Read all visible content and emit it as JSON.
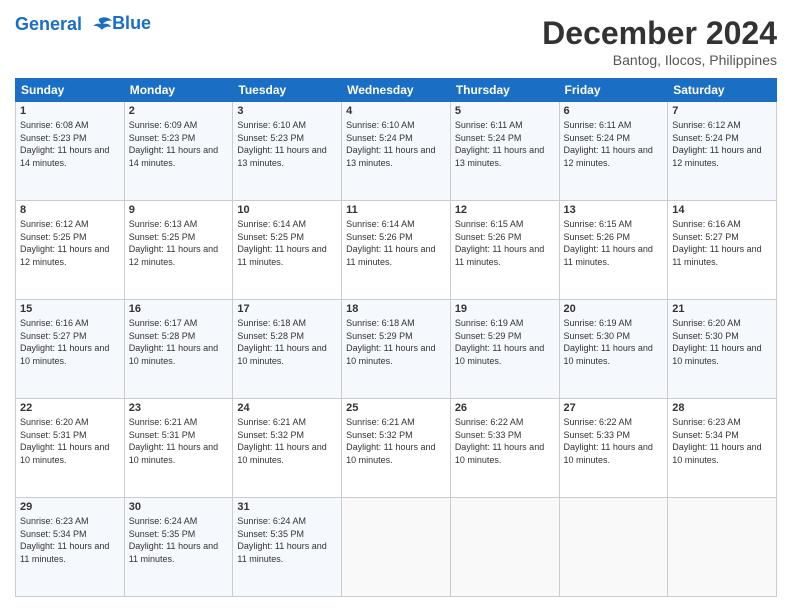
{
  "logo": {
    "line1": "General",
    "line2": "Blue"
  },
  "title": "December 2024",
  "location": "Bantog, Ilocos, Philippines",
  "header_days": [
    "Sunday",
    "Monday",
    "Tuesday",
    "Wednesday",
    "Thursday",
    "Friday",
    "Saturday"
  ],
  "weeks": [
    [
      {
        "day": "1",
        "sunrise": "6:08 AM",
        "sunset": "5:23 PM",
        "daylight": "11 hours and 14 minutes."
      },
      {
        "day": "2",
        "sunrise": "6:09 AM",
        "sunset": "5:23 PM",
        "daylight": "11 hours and 14 minutes."
      },
      {
        "day": "3",
        "sunrise": "6:10 AM",
        "sunset": "5:23 PM",
        "daylight": "11 hours and 13 minutes."
      },
      {
        "day": "4",
        "sunrise": "6:10 AM",
        "sunset": "5:24 PM",
        "daylight": "11 hours and 13 minutes."
      },
      {
        "day": "5",
        "sunrise": "6:11 AM",
        "sunset": "5:24 PM",
        "daylight": "11 hours and 13 minutes."
      },
      {
        "day": "6",
        "sunrise": "6:11 AM",
        "sunset": "5:24 PM",
        "daylight": "11 hours and 12 minutes."
      },
      {
        "day": "7",
        "sunrise": "6:12 AM",
        "sunset": "5:24 PM",
        "daylight": "11 hours and 12 minutes."
      }
    ],
    [
      {
        "day": "8",
        "sunrise": "6:12 AM",
        "sunset": "5:25 PM",
        "daylight": "11 hours and 12 minutes."
      },
      {
        "day": "9",
        "sunrise": "6:13 AM",
        "sunset": "5:25 PM",
        "daylight": "11 hours and 12 minutes."
      },
      {
        "day": "10",
        "sunrise": "6:14 AM",
        "sunset": "5:25 PM",
        "daylight": "11 hours and 11 minutes."
      },
      {
        "day": "11",
        "sunrise": "6:14 AM",
        "sunset": "5:26 PM",
        "daylight": "11 hours and 11 minutes."
      },
      {
        "day": "12",
        "sunrise": "6:15 AM",
        "sunset": "5:26 PM",
        "daylight": "11 hours and 11 minutes."
      },
      {
        "day": "13",
        "sunrise": "6:15 AM",
        "sunset": "5:26 PM",
        "daylight": "11 hours and 11 minutes."
      },
      {
        "day": "14",
        "sunrise": "6:16 AM",
        "sunset": "5:27 PM",
        "daylight": "11 hours and 11 minutes."
      }
    ],
    [
      {
        "day": "15",
        "sunrise": "6:16 AM",
        "sunset": "5:27 PM",
        "daylight": "11 hours and 10 minutes."
      },
      {
        "day": "16",
        "sunrise": "6:17 AM",
        "sunset": "5:28 PM",
        "daylight": "11 hours and 10 minutes."
      },
      {
        "day": "17",
        "sunrise": "6:18 AM",
        "sunset": "5:28 PM",
        "daylight": "11 hours and 10 minutes."
      },
      {
        "day": "18",
        "sunrise": "6:18 AM",
        "sunset": "5:29 PM",
        "daylight": "11 hours and 10 minutes."
      },
      {
        "day": "19",
        "sunrise": "6:19 AM",
        "sunset": "5:29 PM",
        "daylight": "11 hours and 10 minutes."
      },
      {
        "day": "20",
        "sunrise": "6:19 AM",
        "sunset": "5:30 PM",
        "daylight": "11 hours and 10 minutes."
      },
      {
        "day": "21",
        "sunrise": "6:20 AM",
        "sunset": "5:30 PM",
        "daylight": "11 hours and 10 minutes."
      }
    ],
    [
      {
        "day": "22",
        "sunrise": "6:20 AM",
        "sunset": "5:31 PM",
        "daylight": "11 hours and 10 minutes."
      },
      {
        "day": "23",
        "sunrise": "6:21 AM",
        "sunset": "5:31 PM",
        "daylight": "11 hours and 10 minutes."
      },
      {
        "day": "24",
        "sunrise": "6:21 AM",
        "sunset": "5:32 PM",
        "daylight": "11 hours and 10 minutes."
      },
      {
        "day": "25",
        "sunrise": "6:21 AM",
        "sunset": "5:32 PM",
        "daylight": "11 hours and 10 minutes."
      },
      {
        "day": "26",
        "sunrise": "6:22 AM",
        "sunset": "5:33 PM",
        "daylight": "11 hours and 10 minutes."
      },
      {
        "day": "27",
        "sunrise": "6:22 AM",
        "sunset": "5:33 PM",
        "daylight": "11 hours and 10 minutes."
      },
      {
        "day": "28",
        "sunrise": "6:23 AM",
        "sunset": "5:34 PM",
        "daylight": "11 hours and 10 minutes."
      }
    ],
    [
      {
        "day": "29",
        "sunrise": "6:23 AM",
        "sunset": "5:34 PM",
        "daylight": "11 hours and 11 minutes."
      },
      {
        "day": "30",
        "sunrise": "6:24 AM",
        "sunset": "5:35 PM",
        "daylight": "11 hours and 11 minutes."
      },
      {
        "day": "31",
        "sunrise": "6:24 AM",
        "sunset": "5:35 PM",
        "daylight": "11 hours and 11 minutes."
      },
      null,
      null,
      null,
      null
    ]
  ]
}
